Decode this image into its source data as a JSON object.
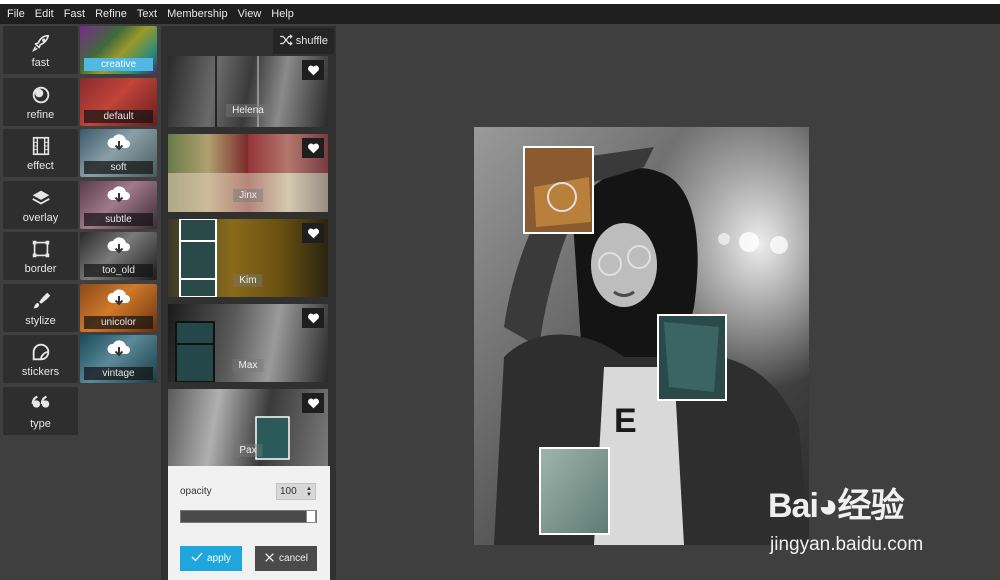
{
  "menu": [
    "File",
    "Edit",
    "Fast",
    "Refine",
    "Text",
    "Membership",
    "View",
    "Help"
  ],
  "tools": [
    {
      "label": "fast",
      "icon": "rocket-icon"
    },
    {
      "label": "refine",
      "icon": "refine-icon"
    },
    {
      "label": "effect",
      "icon": "film-icon"
    },
    {
      "label": "overlay",
      "icon": "layers-icon"
    },
    {
      "label": "border",
      "icon": "border-frame-icon"
    },
    {
      "label": "stylize",
      "icon": "brush-icon"
    },
    {
      "label": "stickers",
      "icon": "sticker-icon"
    },
    {
      "label": "type",
      "icon": "quote-icon"
    }
  ],
  "filters": [
    {
      "label": "creative",
      "active": true
    },
    {
      "label": "default",
      "active": false
    },
    {
      "label": "soft",
      "active": false
    },
    {
      "label": "subtle",
      "active": false
    },
    {
      "label": "too_old",
      "active": false
    },
    {
      "label": "unicolor",
      "active": false
    },
    {
      "label": "vintage",
      "active": false
    }
  ],
  "panel": {
    "shuffle_label": "shuffle",
    "cards": [
      "Helena",
      "Jinx",
      "Kim",
      "Max",
      "Pax"
    ]
  },
  "opacity": {
    "label": "opacity",
    "value": "100",
    "level": 1.0,
    "apply_label": "apply",
    "cancel_label": "cancel"
  },
  "watermark": {
    "logo": "Bai◕经验",
    "url": "jingyan.baidu.com"
  },
  "colors": {
    "accent": "#1fa6dc",
    "active_filter": "#4fb9e3",
    "background": "#3f3f3f"
  }
}
